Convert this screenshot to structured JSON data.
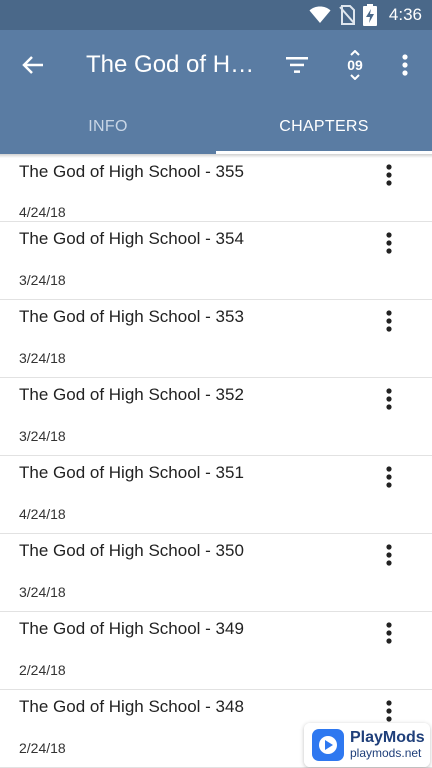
{
  "status_bar": {
    "time": "4:36",
    "icons": [
      "wifi-icon",
      "no-sim-icon",
      "battery-charging-icon"
    ]
  },
  "app_bar": {
    "title": "The God of High School",
    "back_icon": "arrow-back-icon",
    "actions": [
      "filter-icon",
      "sort-numeric-icon",
      "more-vert-icon"
    ],
    "sort_label": "09"
  },
  "tabs": [
    {
      "label": "INFO",
      "active": false
    },
    {
      "label": "CHAPTERS",
      "active": true
    }
  ],
  "chapters": [
    {
      "name": "The God of High School - 355",
      "date": "4/24/18"
    },
    {
      "name": "The God of High School - 354",
      "date": "3/24/18"
    },
    {
      "name": "The God of High School - 353",
      "date": "3/24/18"
    },
    {
      "name": "The God of High School - 352",
      "date": "3/24/18"
    },
    {
      "name": "The God of High School - 351",
      "date": "4/24/18"
    },
    {
      "name": "The God of High School - 350",
      "date": "3/24/18"
    },
    {
      "name": "The God of High School - 349",
      "date": "2/24/18"
    },
    {
      "name": "The God of High School - 348",
      "date": "2/24/18"
    }
  ],
  "watermark": {
    "title": "PlayMods",
    "url": "playmods.net"
  },
  "colors": {
    "app_bar": "#5a7ca3",
    "status_bar": "#4a6889"
  }
}
